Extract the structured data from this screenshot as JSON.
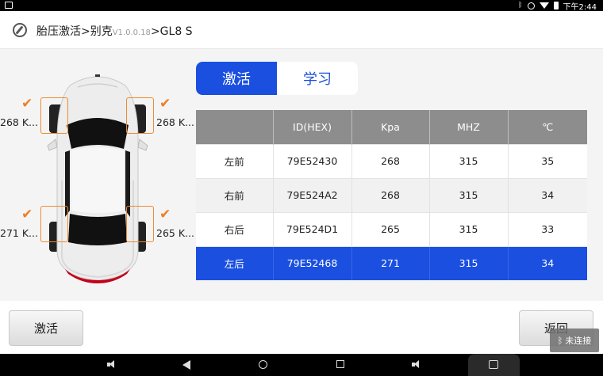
{
  "status_bar": {
    "time": "下午2:44",
    "icons": [
      "notification-icon",
      "bluetooth-icon",
      "do-not-disturb-icon",
      "wifi-icon",
      "battery-icon"
    ]
  },
  "header": {
    "title_prefix": "胎压激活>别克",
    "version": "V1.0.0.18",
    "title_suffix": ">GL8 S",
    "icon": "compass-icon"
  },
  "tabs": [
    {
      "label": "激活",
      "active": true
    },
    {
      "label": "学习",
      "active": false
    }
  ],
  "tires": {
    "front_left": {
      "pressure": "268 K..."
    },
    "front_right": {
      "pressure": "268 K..."
    },
    "rear_left": {
      "pressure": "271 K..."
    },
    "rear_right": {
      "pressure": "265 K..."
    }
  },
  "table": {
    "columns": [
      "",
      "ID(HEX)",
      "Kpa",
      "MHZ",
      "℃"
    ],
    "rows": [
      [
        "左前",
        "79E52430",
        "268",
        "315",
        "35"
      ],
      [
        "右前",
        "79E524A2",
        "268",
        "315",
        "34"
      ],
      [
        "右后",
        "79E524D1",
        "265",
        "315",
        "33"
      ],
      [
        "左后",
        "79E52468",
        "271",
        "315",
        "34"
      ]
    ],
    "selected_row": 3
  },
  "footer": {
    "activate_label": "激活",
    "back_label": "返回",
    "toast": "未连接"
  },
  "colors": {
    "accent": "#1a4fe0",
    "check": "#ef7d22",
    "header_bg": "#8d8d8d"
  }
}
